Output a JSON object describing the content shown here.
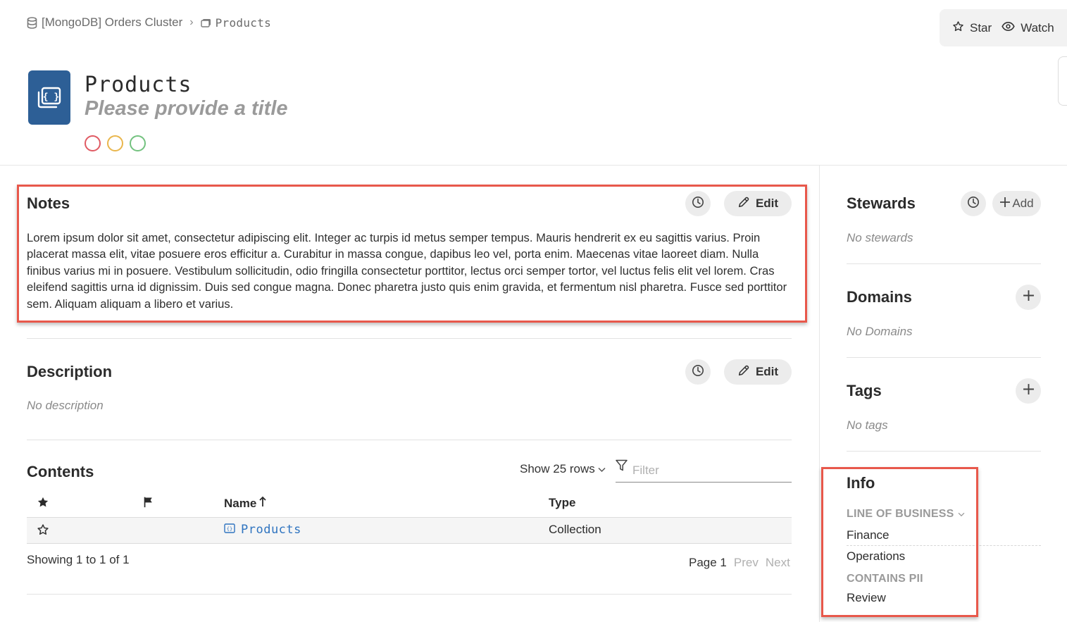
{
  "breadcrumb": {
    "cluster": "[MongoDB] Orders Cluster",
    "current": "Products"
  },
  "actions": {
    "star": "Star",
    "watch": "Watch"
  },
  "asset": {
    "name": "Products",
    "title_placeholder": "Please provide a title"
  },
  "notes": {
    "title": "Notes",
    "edit_label": "Edit",
    "body": "Lorem ipsum dolor sit amet, consectetur adipiscing elit. Integer ac turpis id metus semper tempus. Mauris hendrerit ex eu sagittis varius. Proin placerat massa elit, vitae posuere eros efficitur a. Curabitur in massa congue, dapibus leo vel, porta enim. Maecenas vitae laoreet diam. Nulla finibus varius mi in posuere. Vestibulum sollicitudin, odio fringilla consectetur porttitor, lectus orci semper tortor, vel luctus felis elit vel lorem. Cras eleifend sagittis urna id dignissim. Duis sed congue magna. Donec pharetra justo quis enim gravida, et fermentum nisl pharetra. Fusce sed porttitor sem. Aliquam aliquam a libero et varius."
  },
  "description": {
    "title": "Description",
    "edit_label": "Edit",
    "empty": "No description"
  },
  "contents": {
    "title": "Contents",
    "show_rows": "Show 25 rows",
    "filter_placeholder": "Filter",
    "columns": {
      "name": "Name",
      "type": "Type"
    },
    "rows": [
      {
        "name": "Products",
        "type": "Collection"
      }
    ],
    "showing": "Showing 1 to 1 of 1",
    "page": "Page 1",
    "prev": "Prev",
    "next": "Next"
  },
  "sidebar": {
    "stewards": {
      "title": "Stewards",
      "add_label": "Add",
      "empty": "No stewards"
    },
    "domains": {
      "title": "Domains",
      "empty": "No Domains"
    },
    "tags": {
      "title": "Tags",
      "empty": "No tags"
    },
    "info": {
      "title": "Info",
      "line_of_business_label": "LINE OF BUSINESS",
      "line_of_business_values": [
        "Finance",
        "Operations"
      ],
      "contains_pii_label": "CONTAINS PII",
      "contains_pii_value": "Review"
    }
  },
  "colors": {
    "asset_icon_bg": "#2d5f96",
    "link": "#2f74c0",
    "highlight": "#e8584b",
    "status_red": "#e05a63",
    "status_yellow": "#e9b64c",
    "status_green": "#73c27f"
  },
  "icons": [
    "database-icon",
    "collection-icon",
    "star-icon",
    "eye-icon",
    "history-icon",
    "pencil-icon",
    "plus-icon",
    "filter-icon",
    "flag-icon",
    "chevron-down-icon",
    "sort-arrow-icon"
  ]
}
